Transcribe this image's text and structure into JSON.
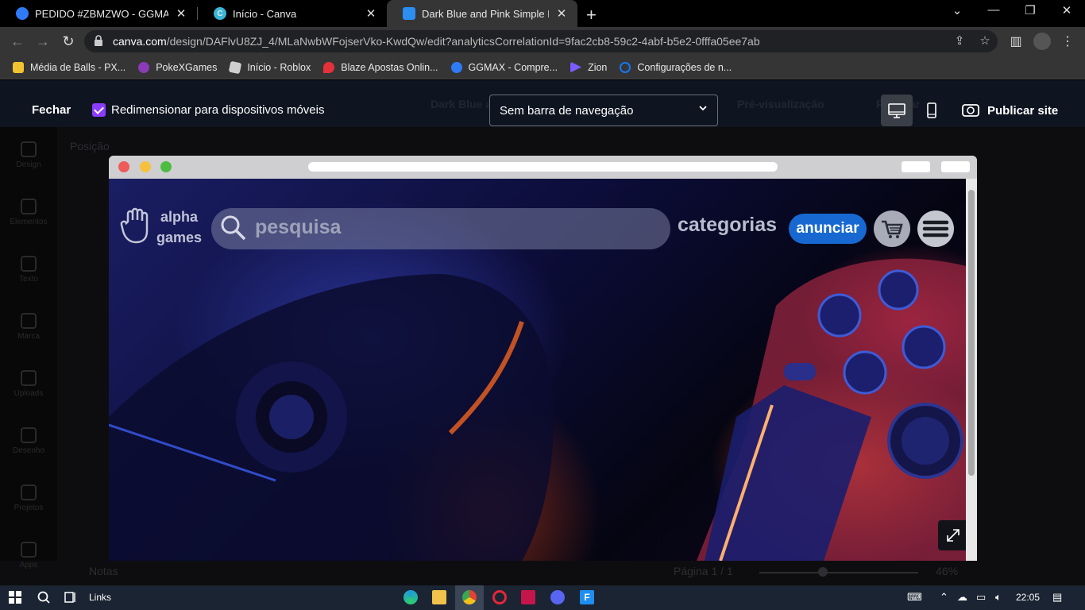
{
  "browser": {
    "tabs": [
      {
        "title": "PEDIDO #ZBMZWO - GGMAX",
        "active": false
      },
      {
        "title": "Início - Canva",
        "active": false
      },
      {
        "title": "Dark Blue and Pink Simple Dark T",
        "active": true
      }
    ],
    "url_host": "canva.com",
    "url_path": "/design/DAFlvU8ZJ_4/MLaNwbWFojserVko-KwdQw/edit?analyticsCorrelationId=9fac2cb8-59c2-4abf-b5e2-0fffa05ee7ab",
    "bookmarks": [
      {
        "label": "Média de Balls - PX...",
        "color": "#f2c230"
      },
      {
        "label": "PokeXGames",
        "color": "#8a3bb5"
      },
      {
        "label": "Início - Roblox",
        "color": "#cfcfcf"
      },
      {
        "label": "Blaze Apostas Onlin...",
        "color": "#e4313b"
      },
      {
        "label": "GGMAX - Compre...",
        "color": "#2f7bf5"
      },
      {
        "label": "Zion",
        "color": "#7a5cff"
      },
      {
        "label": "Configurações de n...",
        "color": "#1877f2"
      }
    ]
  },
  "publish_bar": {
    "close_label": "Fechar",
    "resize_label": "Redimensionar para dispositivos móveis",
    "resize_checked": true,
    "nav_select_value": "Sem barra de navegação",
    "publish_label": "Publicar site",
    "ghost_title": "Dark Blue a",
    "ghost_preview": "Pré-visualização",
    "ghost_share": "Publicar"
  },
  "editor": {
    "position_label": "Posição",
    "rail": [
      "Design",
      "Elementos",
      "Texto",
      "Marca",
      "Uploads",
      "Desenho",
      "Projetos",
      "Apps"
    ],
    "notes_label": "Notas",
    "page_label": "Página 1 / 1",
    "zoom_label": "46%",
    "zoom_level": 0.46
  },
  "site": {
    "brand_line1": "alpha",
    "brand_line2": "games",
    "search_placeholder": "pesquisa",
    "categories_label": "categorias",
    "announce_label": "anunciar"
  },
  "taskbar": {
    "links_label": "Links",
    "clock": "22:05"
  },
  "colors": {
    "accent_purple": "#8b3dff",
    "announce_blue": "#1769d1",
    "publish_bar_bg": "#0e1520"
  }
}
